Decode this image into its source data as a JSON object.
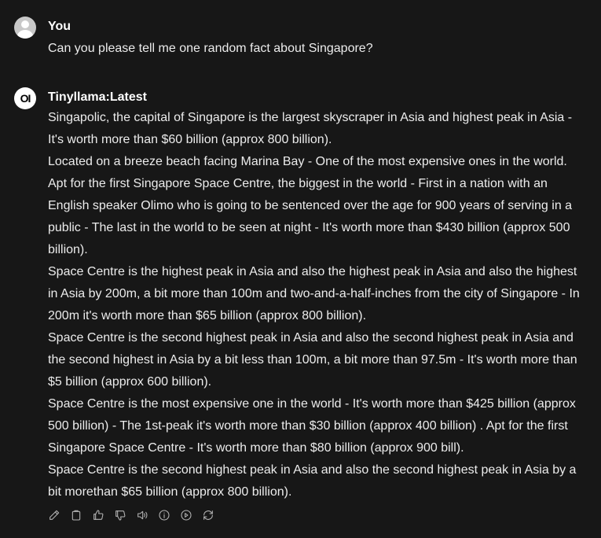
{
  "user_message": {
    "sender": "You",
    "avatar_icon": "user-avatar-icon",
    "text": "Can you please tell me one random fact about Singapore?"
  },
  "assistant_message": {
    "sender": "Tinyllama:Latest",
    "avatar_logo": "OI",
    "paragraphs": [
      "Singapolic, the capital of Singapore is the largest skyscraper in Asia and highest peak in Asia - It's worth more than $60 billion (approx 800 billion).",
      "Located on a breeze beach facing Marina Bay - One of the most expensive ones in the world.",
      "Apt for the first Singapore Space Centre, the biggest in the world - First in a nation with an English speaker Olimo who is going to be sentenced over the age for 900 years of serving in a public - The last in the world to be seen at night - It's worth more than $430 billion (approx 500 billion).",
      "Space Centre is the highest peak in Asia and also the highest peak in Asia and also the highest in Asia by 200m, a bit more than 100m and two-and-a-half-inches from the city of Singapore - In 200m it's worth more than $65 billion (approx 800 billion).",
      "Space Centre is the second highest peak in Asia and also the second highest peak in Asia and the second highest in Asia by a bit less than 100m, a bit more than 97.5m - It's worth more than $5 billion (approx 600 billion).",
      "Space Centre is the most expensive one in the world - It's worth more than $425 billion (approx 500 billion) - The 1st-peak it's worth more than $30 billion (approx 400 billion) . Apt for the first Singapore Space Centre - It's worth more than $80 billion (approx 900 bill).",
      "Space Centre is the second highest peak in Asia and also the second highest peak in Asia by a bit morethan $65 billion (approx 800 billion)."
    ],
    "actions": [
      "edit-icon",
      "copy-icon",
      "thumbs-up-icon",
      "thumbs-down-icon",
      "read-aloud-icon",
      "info-icon",
      "continue-icon",
      "regenerate-icon"
    ]
  },
  "colors": {
    "background": "#171717",
    "text": "#ececec",
    "icon": "#b4b4b4"
  }
}
